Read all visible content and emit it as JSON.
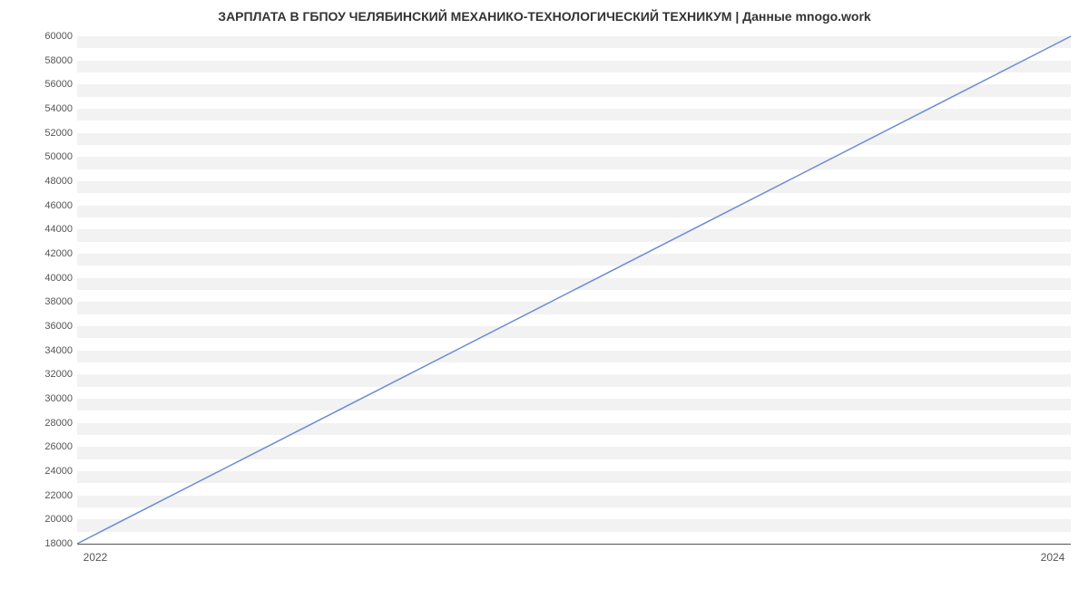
{
  "chart_data": {
    "type": "line",
    "title": "ЗАРПЛАТА В ГБПОУ ЧЕЛЯБИНСКИЙ МЕХАНИКО-ТЕХНОЛОГИЧЕСКИЙ ТЕХНИКУМ | Данные mnogo.work",
    "xlabel": "",
    "ylabel": "",
    "x": [
      2022,
      2024
    ],
    "series": [
      {
        "name": "salary",
        "values": [
          18000,
          60000
        ],
        "color": "#6b8cd4"
      }
    ],
    "xticks": [
      2022,
      2024
    ],
    "yticks": [
      18000,
      20000,
      22000,
      24000,
      26000,
      28000,
      30000,
      32000,
      34000,
      36000,
      38000,
      40000,
      42000,
      44000,
      46000,
      48000,
      50000,
      52000,
      54000,
      56000,
      58000,
      60000
    ],
    "xlim": [
      2022,
      2024
    ],
    "ylim": [
      18000,
      60000
    ]
  }
}
